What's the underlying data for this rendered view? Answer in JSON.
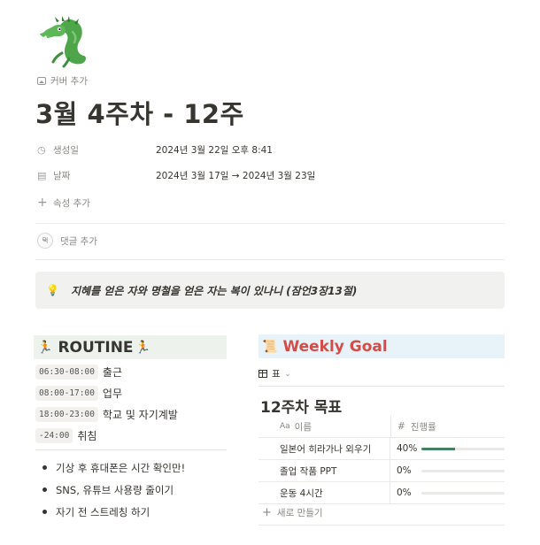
{
  "page": {
    "icon": "dragon-emoji",
    "cover_add": "커버 추가",
    "title": "3월 4주차 - 12주"
  },
  "properties": [
    {
      "icon": "clock-icon",
      "name": "생성일",
      "value": "2024년 3월 22일 오후 8:41"
    },
    {
      "icon": "calendar-icon",
      "name": "날짜",
      "value": "2024년 3월 17일 → 2024년 3월 23일"
    }
  ],
  "add_property": "속성 추가",
  "comment": {
    "avatar": "택",
    "label": "댓글 추가"
  },
  "callout": {
    "icon": "lightbulb-icon",
    "text": "지혜를 얻은 자와 명철을 얻은 자는 복이 있나니 (잠언3장13절)"
  },
  "routine": {
    "heading": "ROUTINE",
    "emoji": "🏃",
    "times": [
      {
        "time": "06:30-08:00",
        "label": "출근"
      },
      {
        "time": "08:00-17:00",
        "label": "업무"
      },
      {
        "time": "18:00-23:00",
        "label": "학교 및 자기계발"
      },
      {
        "time": "-24:00",
        "label": "취침"
      }
    ],
    "bullets": [
      "기상 후 휴대폰은 시간 확인만!",
      "SNS, 유튜브 사용량 줄이기",
      "자기 전 스트레칭 하기"
    ]
  },
  "goal": {
    "heading": "Weekly Goal",
    "emoji": "📜",
    "view_label": "표",
    "db_title": "12주차 목표",
    "col_name_prefix": "Aa",
    "col_name": "이름",
    "col_progress_prefix": "#",
    "col_progress": "진행률",
    "rows": [
      {
        "name": "일본어 히라가나 외우기",
        "progress_text": "40%",
        "progress": 0.4
      },
      {
        "name": "졸업 작품 PPT",
        "progress_text": "0%",
        "progress": 0
      },
      {
        "name": "운동 4시간",
        "progress_text": "0%",
        "progress": 0
      }
    ],
    "new_label": "새로 만들기"
  },
  "colors": {
    "text": "#37352f",
    "muted": "#8a8883",
    "goal_heading": "#d44c47",
    "progress": "#448361",
    "routine_bg": "#edf3ec",
    "goal_bg": "#e7f3f8"
  }
}
